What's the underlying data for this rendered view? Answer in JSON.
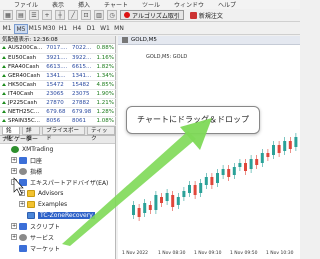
{
  "menu": [
    "ファイル",
    "表示",
    "挿入",
    "チャート",
    "ツール",
    "ウィンドウ",
    "ヘルプ"
  ],
  "toolbar": {
    "algo_label": "アルゴリズム取引",
    "new_order_label": "新規注文"
  },
  "timeframes": [
    "M1",
    "M5",
    "M15",
    "M30",
    "H1",
    "H4",
    "D1",
    "W1",
    "MN"
  ],
  "active_timeframe": "M5",
  "market_watch": {
    "title": "気配値表示: 12:36:08",
    "rows": [
      {
        "symbol": "AUS200Ca...",
        "bid": "7017....",
        "ask": "7022...",
        "change": "0.88%",
        "dir": "up"
      },
      {
        "symbol": "EU50Cash",
        "bid": "3921....",
        "ask": "3922...",
        "change": "1.16%",
        "dir": "up"
      },
      {
        "symbol": "FRA40Cash",
        "bid": "6613....",
        "ask": "6615...",
        "change": "1.82%",
        "dir": "up"
      },
      {
        "symbol": "GER40Cash",
        "bid": "1341...",
        "ask": "1341...",
        "change": "1.34%",
        "dir": "up"
      },
      {
        "symbol": "HK50Cash",
        "bid": "15472",
        "ask": "15482",
        "change": "4.85%",
        "dir": "up"
      },
      {
        "symbol": "IT40Cash",
        "bid": "23065",
        "ask": "23075",
        "change": "1.90%",
        "dir": "up"
      },
      {
        "symbol": "JP225Cash",
        "bid": "27870",
        "ask": "27882",
        "change": "1.21%",
        "dir": "up"
      },
      {
        "symbol": "NETH25C...",
        "bid": "679.68",
        "ask": "679.98",
        "change": "1.28%",
        "dir": "up"
      },
      {
        "symbol": "SPAIN35C...",
        "bid": "8056",
        "ask": "8061",
        "change": "1.08%",
        "dir": "up"
      }
    ],
    "tabs": [
      "銘柄",
      "詳細",
      "プライスボード",
      "ティック"
    ]
  },
  "navigator": {
    "title": "ナビゲーター",
    "items": [
      {
        "label": "XMTrading",
        "icon": "logo-icon",
        "level": 0,
        "expander": ""
      },
      {
        "label": "口座",
        "icon": "accounts-icon",
        "level": 1,
        "expander": "+"
      },
      {
        "label": "指標",
        "icon": "indicators-icon",
        "level": 1,
        "expander": "+"
      },
      {
        "label": "エキスパートアドバイザ(EA)",
        "icon": "experts-icon",
        "level": 1,
        "expander": "-"
      },
      {
        "label": "Advisors",
        "icon": "folder-icon",
        "level": 2,
        "expander": "+"
      },
      {
        "label": "Examples",
        "icon": "folder-icon",
        "level": 2,
        "expander": "+"
      },
      {
        "label": "TC-ZoneRecovery",
        "icon": "ea-icon",
        "level": 2,
        "expander": "",
        "selected": true
      },
      {
        "label": "スクリプト",
        "icon": "scripts-icon",
        "level": 1,
        "expander": "+"
      },
      {
        "label": "サービス",
        "icon": "services-icon",
        "level": 1,
        "expander": "+"
      },
      {
        "label": "マーケット",
        "icon": "market-icon",
        "level": 1,
        "expander": ""
      }
    ]
  },
  "chart": {
    "tab_label": "GOLD,M5",
    "label": "GOLD,M5: GOLD",
    "x_labels": [
      "1 Nov 2022",
      "1 Nov 08:30",
      "1 Nov 09:10",
      "1 Nov 09:50",
      "1 Nov 10:30"
    ],
    "callout": "チャートにドラッグ＆ドロップ",
    "colors": {
      "up": "#2aa198",
      "down": "#e0463a",
      "arrow": "#7ed957"
    }
  }
}
